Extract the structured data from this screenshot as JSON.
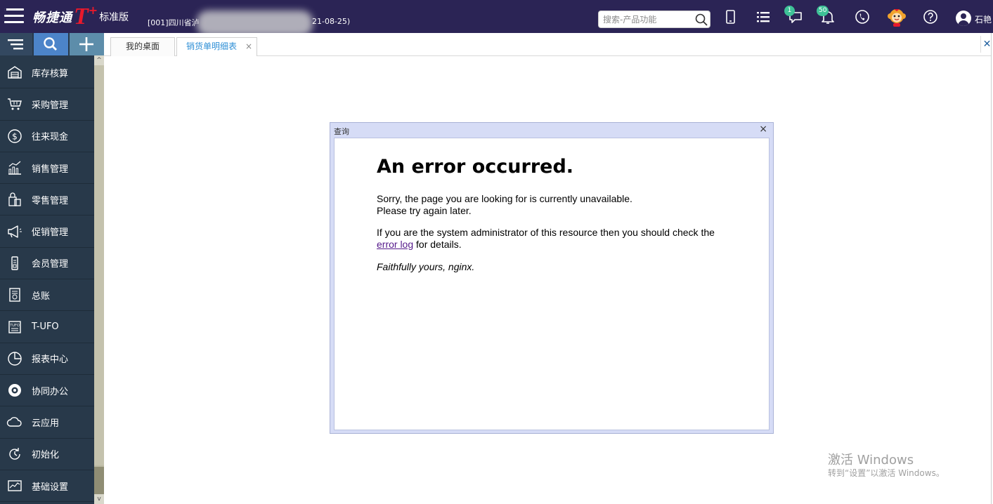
{
  "header": {
    "brand_name": "畅捷通",
    "brand_t": "T",
    "brand_plus": "+",
    "edition": "标准版",
    "account_prefix": "[001]四川省泸",
    "account_date": "21-08-25)",
    "search_placeholder": "搜索-产品功能",
    "message_badge": "1",
    "notification_badge": "50",
    "user_name": "石艳"
  },
  "sidebar": {
    "items": [
      {
        "label": "库存核算",
        "icon": "warehouse-icon"
      },
      {
        "label": "采购管理",
        "icon": "shopping-cart-icon"
      },
      {
        "label": "往来现金",
        "icon": "dollar-icon"
      },
      {
        "label": "销售管理",
        "icon": "bar-chart-icon"
      },
      {
        "label": "零售管理",
        "icon": "shopping-bag-icon"
      },
      {
        "label": "促销管理",
        "icon": "megaphone-icon"
      },
      {
        "label": "会员管理",
        "icon": "member-card-icon"
      },
      {
        "label": "总账",
        "icon": "ledger-icon"
      },
      {
        "label": "T-UFO",
        "icon": "tufo-icon"
      },
      {
        "label": "报表中心",
        "icon": "pie-chart-icon"
      },
      {
        "label": "协同办公",
        "icon": "collaboration-icon"
      },
      {
        "label": "云应用",
        "icon": "cloud-icon"
      },
      {
        "label": "初始化",
        "icon": "refresh-icon"
      },
      {
        "label": "基础设置",
        "icon": "settings-chart-icon"
      }
    ],
    "scroll_up": "^",
    "scroll_down": "v"
  },
  "tabs": [
    {
      "label": "我的桌面"
    },
    {
      "label": "销货单明细表",
      "close": "×"
    }
  ],
  "close_all": "✕",
  "dialog": {
    "title": "查询",
    "close": "×",
    "heading": "An error occurred.",
    "line1": "Sorry, the page you are looking for is currently unavailable.",
    "line2": "Please try again later.",
    "line3": "If you are the system administrator of this resource then you should check the",
    "link": "error log",
    "line4_suffix": " for details.",
    "sign": "Faithfully yours, nginx."
  },
  "watermark": {
    "title": "激活 Windows",
    "subtitle": "转到“设置”以激活 Windows。"
  },
  "colors": {
    "header_bg": "#2b2455",
    "sidebar_bg": "#28394a",
    "brand_red": "#e8192c",
    "active_tab": "#2f8fd6",
    "badge": "#3ec197"
  }
}
